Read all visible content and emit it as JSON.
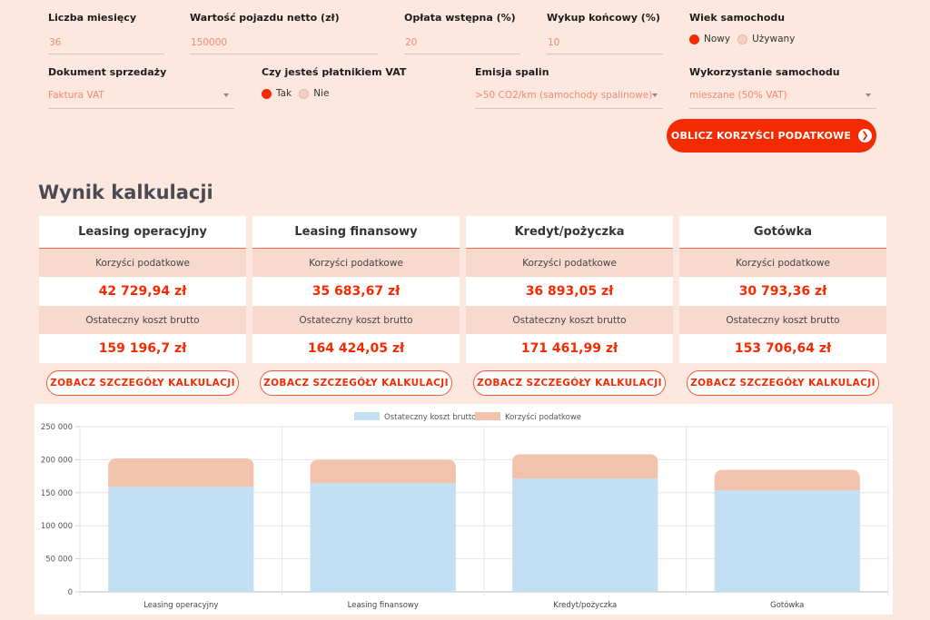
{
  "form": {
    "months_label": "Liczba miesięcy",
    "months_value": "36",
    "vehicle_value_label": "Wartość pojazdu netto (zł)",
    "vehicle_value_value": "150000",
    "down_payment_label": "Opłata wstępna (%)",
    "down_payment_value": "20",
    "buyout_label": "Wykup końcowy (%)",
    "buyout_value": "10",
    "car_age_label": "Wiek samochodu",
    "car_age_options": [
      "Nowy",
      "Używany"
    ],
    "sale_doc_label": "Dokument sprzedaży",
    "sale_doc_value": "Faktura VAT",
    "vat_payer_label": "Czy jesteś płatnikiem VAT",
    "vat_payer_options": [
      "Tak",
      "Nie"
    ],
    "emission_label": "Emisja spalin",
    "emission_value": ">50 CO2/km (samochody spalinowe)",
    "usage_label": "Wykorzystanie samochodu",
    "usage_value": "mieszane (50% VAT)",
    "calculate_label": "OBLICZ KORZYŚCI PODATKOWE"
  },
  "results": {
    "title": "Wynik kalkulacji",
    "tax_benefit_label": "Korzyści podatkowe",
    "final_cost_label": "Ostateczny koszt brutto",
    "details_label": "ZOBACZ SZCZEGÓŁY KALKULACJI",
    "cards": [
      {
        "name": "Leasing operacyjny",
        "tax_benefit": "42 729,94 zł",
        "final_cost": "159 196,7 zł"
      },
      {
        "name": "Leasing finansowy",
        "tax_benefit": "35 683,67 zł",
        "final_cost": "164 424,05 zł"
      },
      {
        "name": "Kredyt/pożyczka",
        "tax_benefit": "36 893,05 zł",
        "final_cost": "171 461,99 zł"
      },
      {
        "name": "Gotówka",
        "tax_benefit": "30 793,36 zł",
        "final_cost": "153 706,64 zł"
      }
    ]
  },
  "colors": {
    "accent": "#f42b00",
    "background": "#fde8df",
    "series_cost": "#c3dff3",
    "series_benefit": "#f1c3ac"
  },
  "chart_data": {
    "type": "bar",
    "stacked": true,
    "categories": [
      "Leasing operacyjny",
      "Leasing finansowy",
      "Kredyt/pożyczka",
      "Gotówka"
    ],
    "series": [
      {
        "name": "Ostateczny koszt brutto",
        "values": [
          159196.7,
          164424.05,
          171461.99,
          153706.64
        ]
      },
      {
        "name": "Korzyści podatkowe",
        "values": [
          42729.94,
          35683.67,
          36893.05,
          30793.36
        ]
      }
    ],
    "ylim": [
      0,
      250000
    ],
    "yticks": [
      0,
      50000,
      100000,
      150000,
      200000,
      250000
    ],
    "ytick_labels": [
      "0",
      "50 000",
      "100 000",
      "150 000",
      "200 000",
      "250 000"
    ],
    "legend": "top-center",
    "grid": true
  }
}
